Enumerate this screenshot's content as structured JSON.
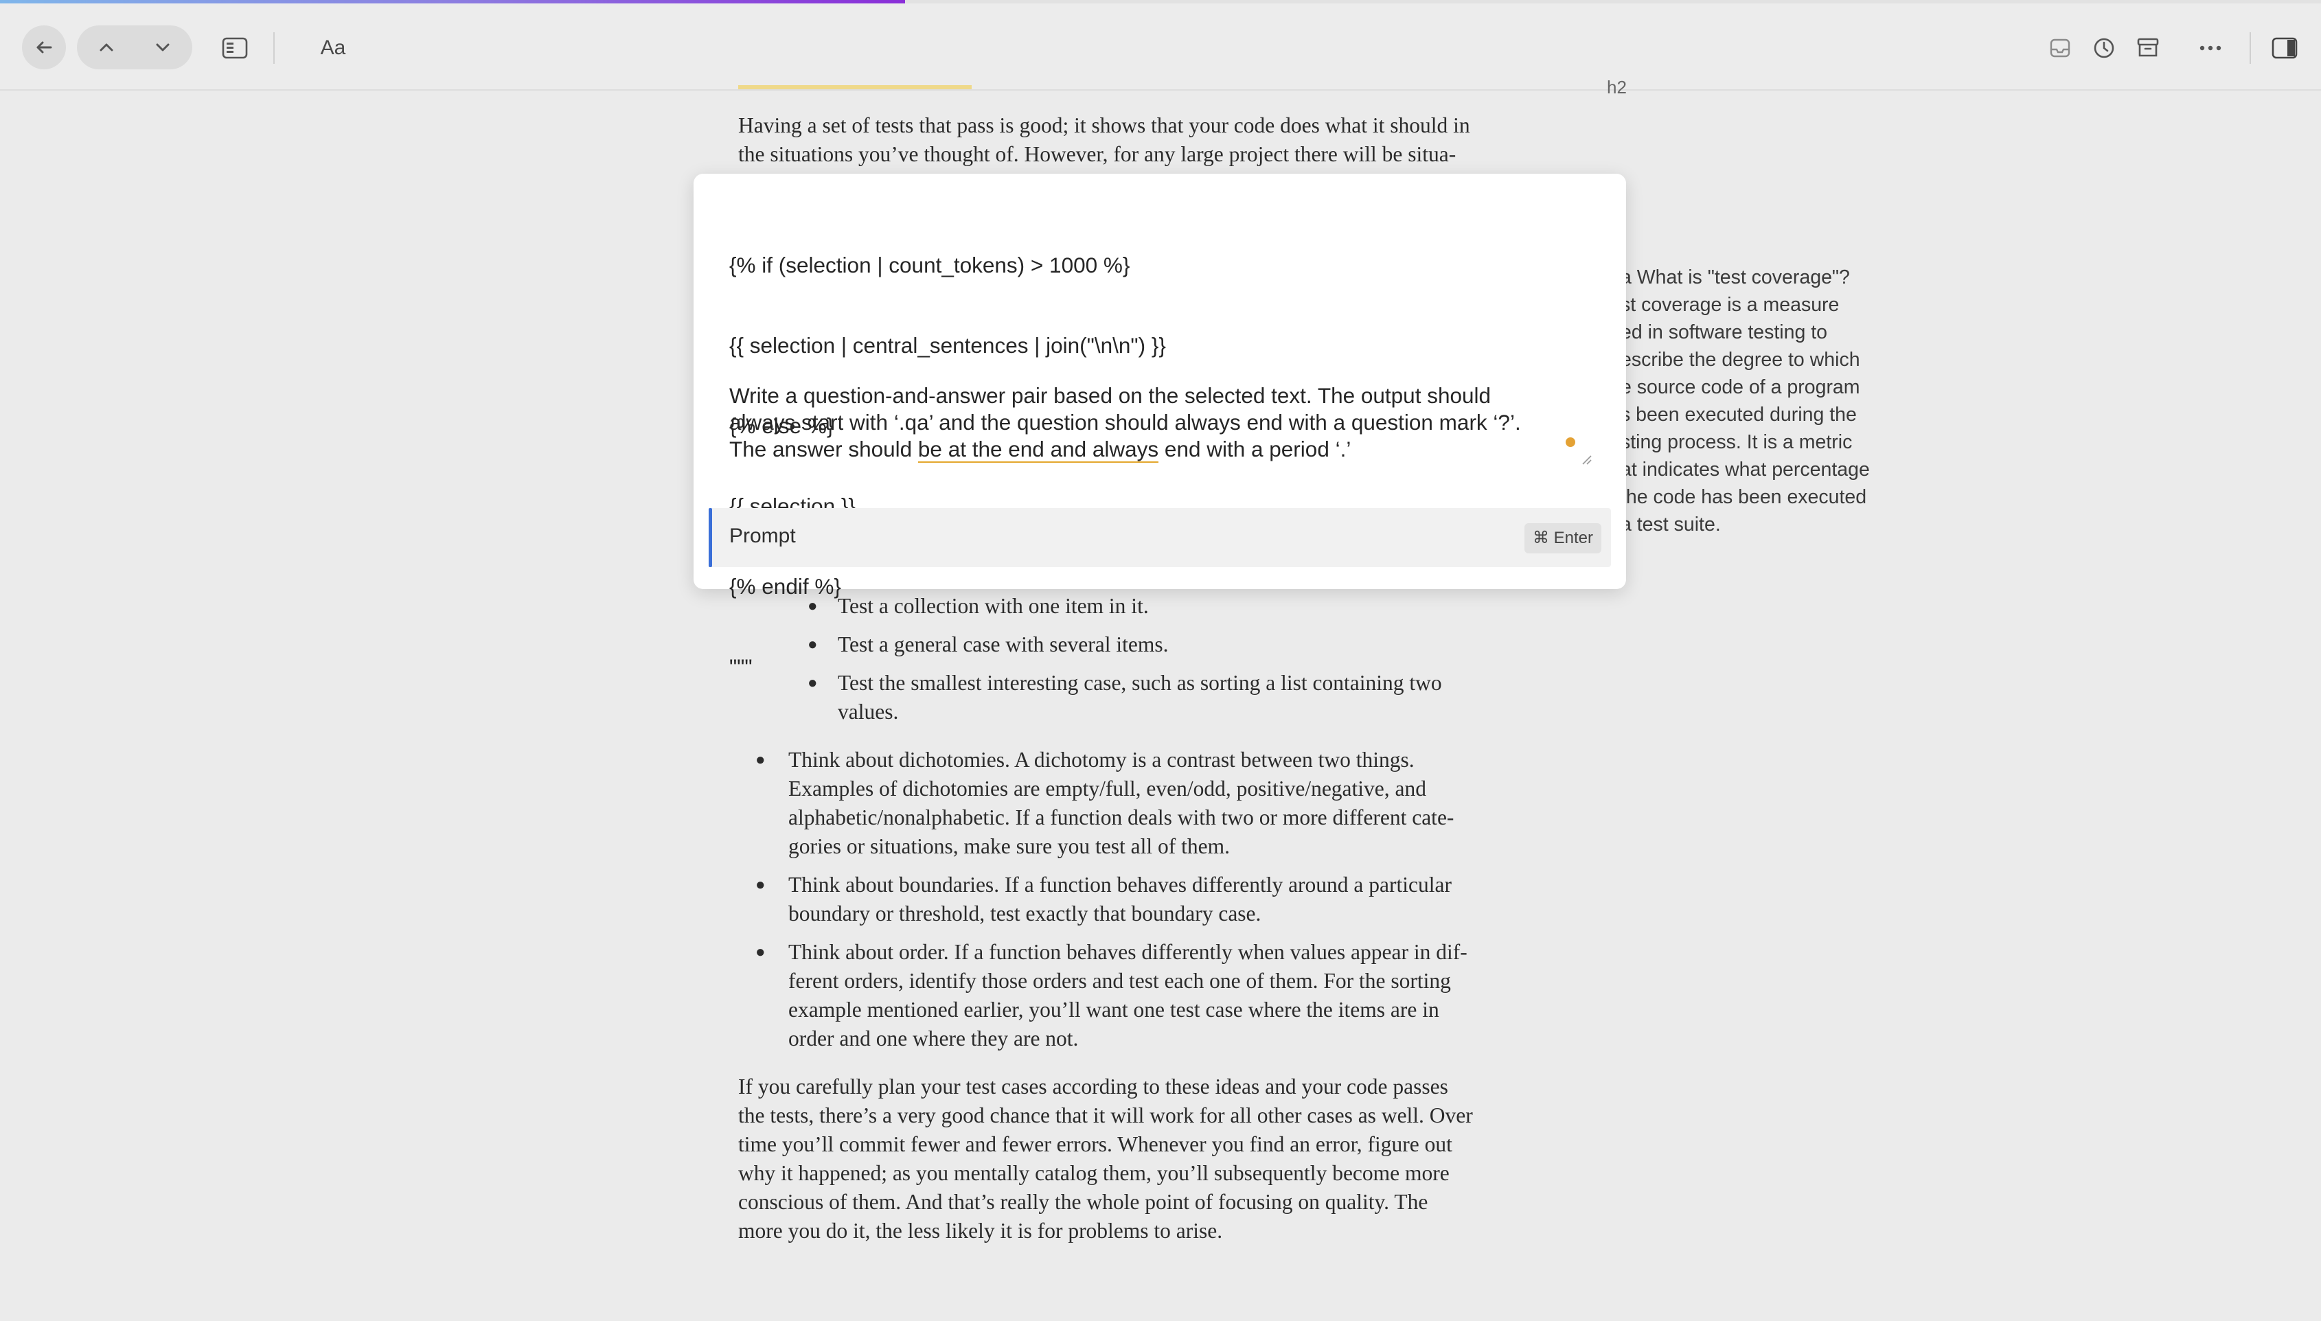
{
  "progress": {
    "fraction": 0.39
  },
  "toolbar": {
    "font_label": "Aa"
  },
  "document": {
    "heading_fragment": "h2",
    "intro_lines": [
      "Having a set of tests that pass is good; it shows that your code does what it should in",
      "the situations you’ve thought of. However, for any large project there will be situa-"
    ],
    "sub_bullets": [
      [
        "Test a collection with one item in it."
      ],
      [
        "Test a general case with several items."
      ],
      [
        "Test the smallest interesting case, such as sorting a list containing two",
        "values."
      ]
    ],
    "bullets": [
      [
        "Think about dichotomies. A dichotomy is a contrast between two things.",
        "Examples of dichotomies are empty/full, even/odd, positive/negative, and",
        "alphabetic/nonalphabetic. If a function deals with two or more different cate-",
        "gories or situations, make sure you test all of them."
      ],
      [
        "Think about boundaries. If a function behaves differently around a particular",
        "boundary or threshold, test exactly that boundary case."
      ],
      [
        "Think about order. If a function behaves differently when values appear in dif-",
        "ferent orders, identify those orders and test each one of them. For the sorting",
        "example mentioned earlier, you’ll want one test case where the items are in",
        "order and one where they are not."
      ]
    ],
    "closing_lines": [
      "If you carefully plan your test cases according to these ideas and your code passes",
      "the tests, there’s a very good chance that it will work for all other cases as well. Over",
      "time you’ll commit fewer and fewer errors. Whenever you find an error, figure out",
      "why it happened; as you mentally catalog them, you’ll subsequently become more",
      "conscious of them. And that’s really the whole point of focusing on quality. The",
      "more you do it, the less likely it is for problems to arise."
    ]
  },
  "margin_note": {
    "lines": [
      "a What is \"test coverage\"?",
      "st coverage is a measure",
      "ed in software testing to",
      "escribe the degree to which",
      "e source code of a program",
      "s been executed during the",
      "sting process. It is a metric",
      "at indicates what percentage",
      "the code has been executed",
      "a test suite."
    ]
  },
  "prompt_dialog": {
    "template_lines": [
      "{% if (selection | count_tokens) > 1000 %}",
      "{{ selection | central_sentences | join(\"\\n\\n\") }}",
      "{% else %}",
      "{{ selection }}",
      "{% endif %}",
      "\"\"\""
    ],
    "instruction_line1": "Write a question-and-answer pair based on the selected text. The output should",
    "instruction_line2": "always start with ‘.qa’ and the question should always end with a question mark ‘?’.",
    "instruction_line3_pre": "The answer should ",
    "instruction_line3_underlined": "be at the end and always",
    "instruction_line3_post": " end with a period ‘.’",
    "footer_label": "Prompt",
    "shortcut": "⌘ Enter",
    "accent_color": "#3a6fd8"
  }
}
